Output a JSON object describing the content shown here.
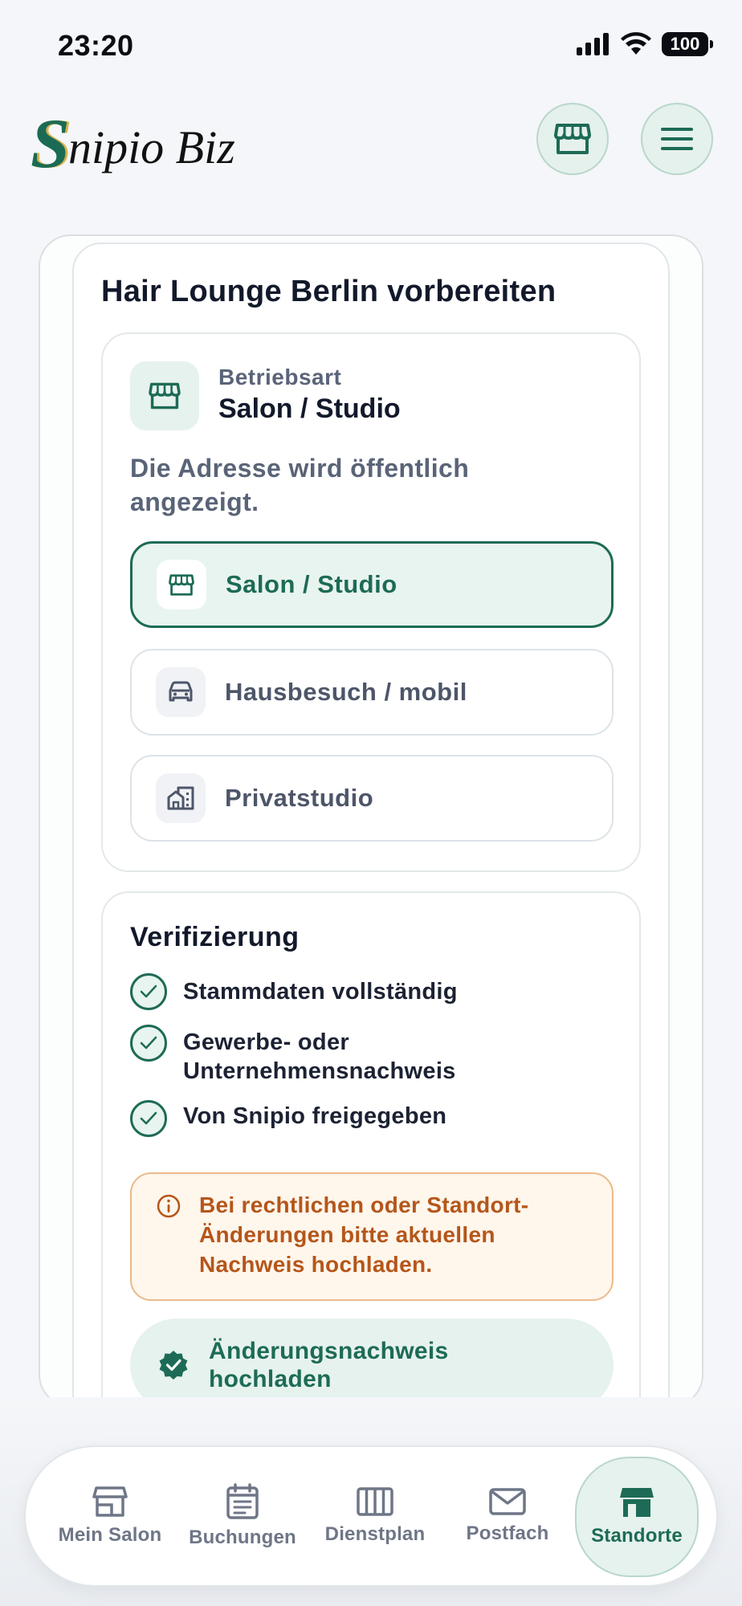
{
  "status_bar": {
    "time": "23:20",
    "battery": "100"
  },
  "header": {
    "logo_letter": "S",
    "logo_text": "nipio Biz",
    "shop_button_icon": "storefront-icon",
    "menu_button_icon": "hamburger-menu-icon"
  },
  "page": {
    "title": "Hair Lounge Berlin vorbereiten"
  },
  "business_type": {
    "label": "Betriebsart",
    "value": "Salon / Studio",
    "description": "Die Adresse wird öffentlich angezeigt.",
    "options": [
      {
        "label": "Salon / Studio",
        "icon": "storefront-icon",
        "selected": true
      },
      {
        "label": "Hausbesuch / mobil",
        "icon": "car-icon",
        "selected": false
      },
      {
        "label": "Privatstudio",
        "icon": "building-icon",
        "selected": false
      }
    ]
  },
  "verification": {
    "title": "Verifizierung",
    "items": [
      {
        "label": "Stammdaten vollständig",
        "done": true
      },
      {
        "label": "Gewerbe- oder Unternehmensnachweis",
        "done": true
      },
      {
        "label": "Von Snipio freigegeben",
        "done": true
      }
    ],
    "notice": "Bei rechtlichen oder Standort-Änderungen bitte aktuellen Nachweis hochladen.",
    "upload_button": "Änderungsnachweis hochladen"
  },
  "bottom_nav": [
    {
      "label": "Mein Salon",
      "icon": "store-icon",
      "active": false
    },
    {
      "label": "Buchungen",
      "icon": "calendar-icon",
      "active": false
    },
    {
      "label": "Dienstplan",
      "icon": "schedule-columns-icon",
      "active": false
    },
    {
      "label": "Postfach",
      "icon": "mail-icon",
      "active": false
    },
    {
      "label": "Standorte",
      "icon": "storefront-filled-icon",
      "active": true
    }
  ],
  "colors": {
    "brand_green": "#1d6b56",
    "brand_green_light": "#e6f2ed",
    "logo_gold": "#d8b24a",
    "warning_text": "#b5561a",
    "warning_bg": "#fff6ec"
  }
}
